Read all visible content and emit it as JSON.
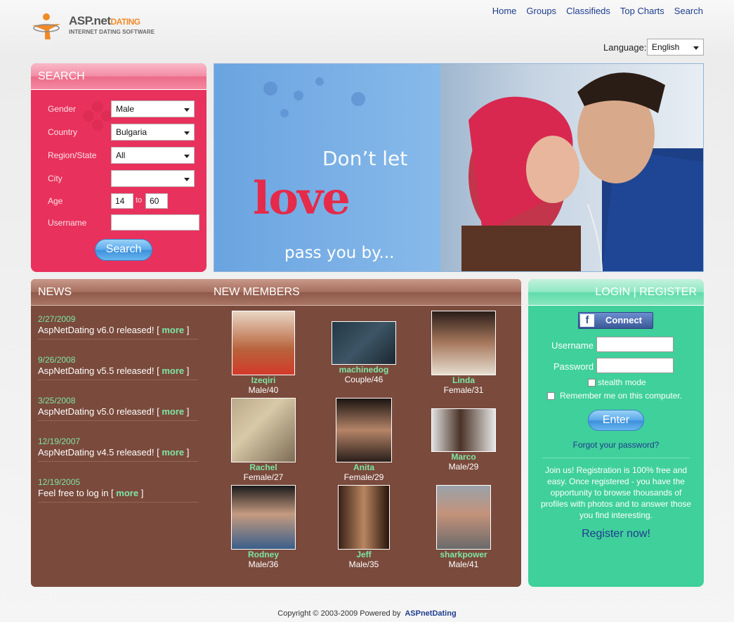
{
  "header": {
    "logo_main": "ASP.net",
    "logo_accent": "DATING",
    "logo_sub": "INTERNET DATING SOFTWARE",
    "nav": [
      "Home",
      "Groups",
      "Classifieds",
      "Top Charts",
      "Search"
    ]
  },
  "language": {
    "label": "Language:",
    "value": "English"
  },
  "search": {
    "title": "SEARCH",
    "gender_label": "Gender",
    "gender_value": "Male",
    "country_label": "Country",
    "country_value": "Bulgaria",
    "region_label": "Region/State",
    "region_value": "All",
    "city_label": "City",
    "city_value": "",
    "age_label": "Age",
    "age_from": "14",
    "age_to_label": "to",
    "age_to": "60",
    "username_label": "Username",
    "username_value": "",
    "button": "Search"
  },
  "banner": {
    "line1": "Don’t let",
    "line2": "love",
    "line3": "pass you by..."
  },
  "news": {
    "title": "NEWS",
    "items": [
      {
        "date": "2/27/2009",
        "text": "AspNetDating v6.0 released! [",
        "more": "more",
        "close": "]"
      },
      {
        "date": "9/26/2008",
        "text": "AspNetDating v5.5 released! [",
        "more": "more",
        "close": "]"
      },
      {
        "date": "3/25/2008",
        "text": "AspNetDating v5.0 released! [",
        "more": "more",
        "close": "]"
      },
      {
        "date": "12/19/2007",
        "text": "AspNetDating v4.5 released! [",
        "more": "more",
        "close": "]"
      },
      {
        "date": "12/19/2005",
        "text": "Feel free to log in [",
        "more": "more",
        "close": "]"
      }
    ]
  },
  "members": {
    "title": "NEW MEMBERS",
    "list": [
      {
        "name": "Izeqiri",
        "info": "Male/40"
      },
      {
        "name": "machinedog",
        "info": "Couple/46"
      },
      {
        "name": "Linda",
        "info": "Female/31"
      },
      {
        "name": "Rachel",
        "info": "Female/27"
      },
      {
        "name": "Anita",
        "info": "Female/29"
      },
      {
        "name": "Marco",
        "info": "Male/29"
      },
      {
        "name": "Rodney",
        "info": "Male/36"
      },
      {
        "name": "Jeff",
        "info": "Male/35"
      },
      {
        "name": "sharkpower",
        "info": "Male/41"
      }
    ]
  },
  "login": {
    "title": "LOGIN | REGISTER",
    "connect": "Connect",
    "username_label": "Username",
    "password_label": "Password",
    "stealth": "stealth mode",
    "remember": "Remember me on this computer.",
    "enter": "Enter",
    "forgot": "Forgot your password?",
    "join_text": "Join us! Registration is 100% free and easy. Once registered - you have the opportunity to browse thousands of profiles with photos and to answer those you find interesting.",
    "register": "Register now!"
  },
  "footer": {
    "text": "Copyright © 2003-2009 Powered by",
    "brand": "ASPnetDating"
  }
}
